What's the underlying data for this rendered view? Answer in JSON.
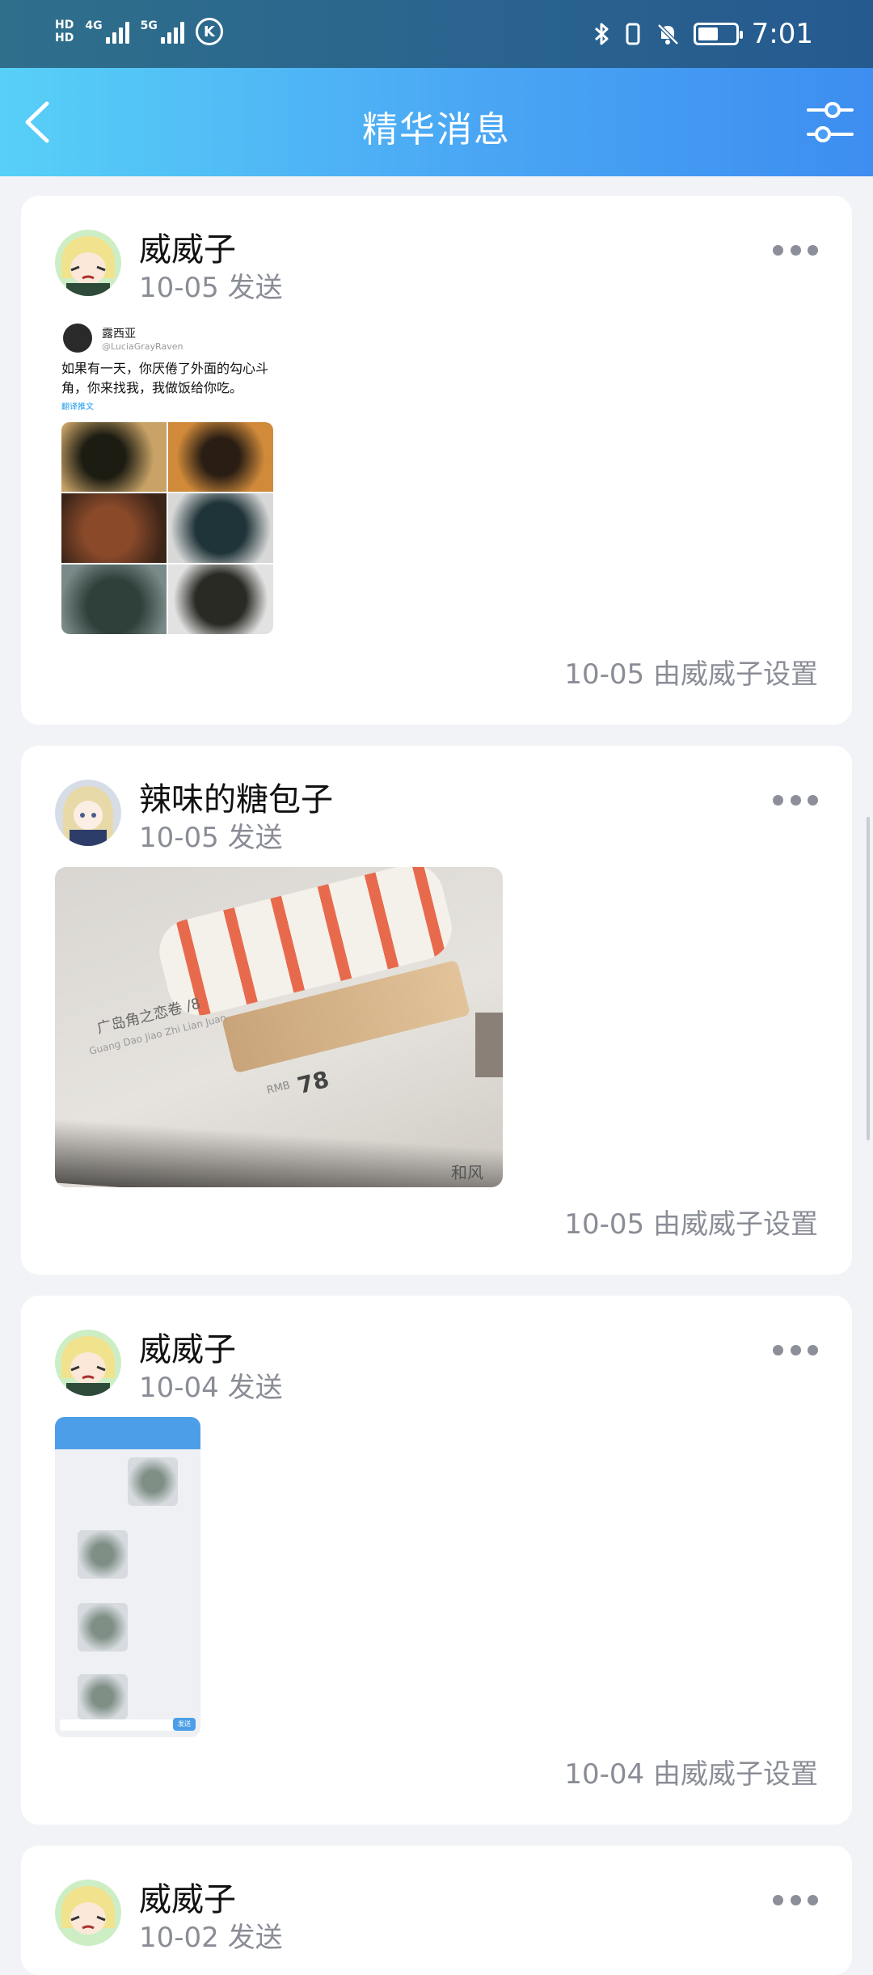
{
  "status_bar": {
    "hd1": "HD",
    "hd2": "HD",
    "net1": "4G",
    "net2": "5G",
    "k_icon": "K",
    "time": "7:01",
    "icons": [
      "bluetooth-icon",
      "vibrate-icon",
      "mute-bell-icon",
      "battery-icon"
    ]
  },
  "header": {
    "title": "精华消息",
    "back_icon": "chevron-left-icon",
    "filter_icon": "sliders-icon"
  },
  "posts": [
    {
      "author": "威威子",
      "sent": "10-05 发送",
      "set_by": "10-05 由威威子设置",
      "image": {
        "tweet_name": "露西亚",
        "tweet_handle": "@LuciaGrayRaven",
        "tweet_text": "如果有一天，你厌倦了外面的勾心斗角，你来找我，我做饭给你吃。",
        "translate": "翻译推文"
      }
    },
    {
      "author": "辣味的糖包子",
      "sent": "10-05 发送",
      "set_by": "10-05 由威威子设置",
      "image": {
        "menu_title": "广岛角之恋卷 /8",
        "menu_sub": "Guang Dao Jiao Zhi Lian Juan",
        "price_label": "RMB",
        "price": "78",
        "corner_text": "和风"
      }
    },
    {
      "author": "威威子",
      "sent": "10-04 发送",
      "set_by": "10-04 由威威子设置",
      "image": {
        "send_label": "发送"
      }
    },
    {
      "author": "威威子",
      "sent": "10-02 发送"
    }
  ],
  "colors": {
    "header_start": "#57d0f7",
    "header_end": "#3d8ef0",
    "background": "#f2f3f6",
    "meta_text": "#8a8d96"
  }
}
